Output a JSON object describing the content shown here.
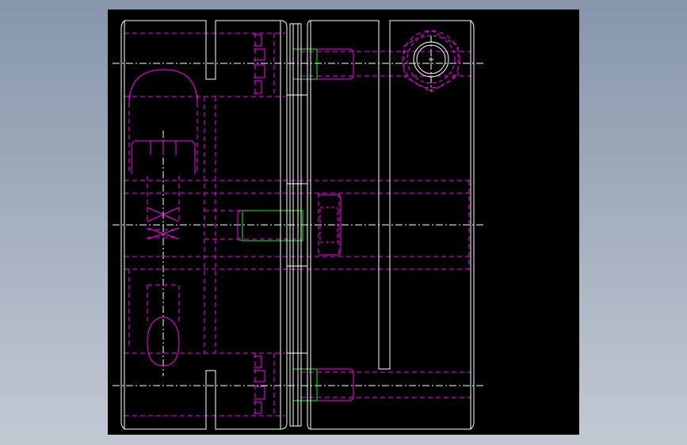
{
  "viewport": {
    "background_color": "#000000",
    "page_background": "#9aa5b6"
  },
  "drawing": {
    "description_colors": {
      "outline": "#ffffff",
      "hidden": "#ff00ff",
      "center": "#ffffff",
      "screw": "#00ff00"
    }
  }
}
